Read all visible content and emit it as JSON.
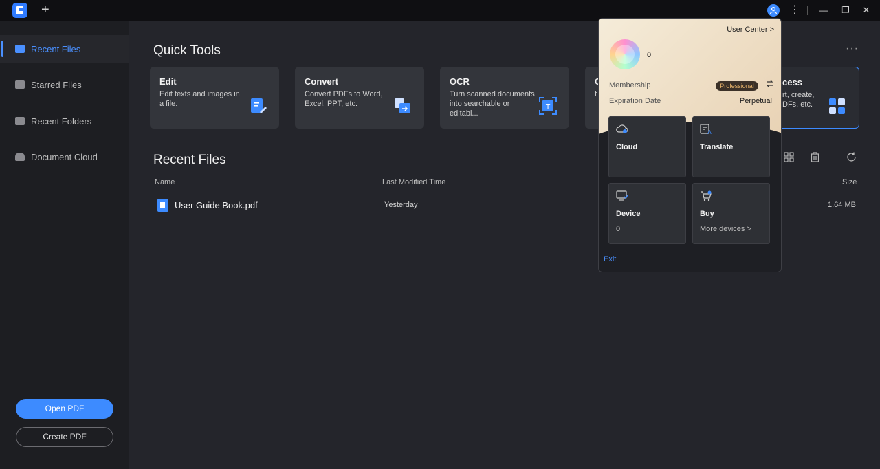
{
  "titlebar": {
    "new_tab": "+",
    "more": "⋮",
    "minimize": "—",
    "restore": "❐",
    "close": "✕"
  },
  "sidebar": {
    "items": [
      {
        "label": "Recent Files",
        "icon": "document-icon",
        "active": true
      },
      {
        "label": "Starred Files",
        "icon": "star-icon",
        "active": false
      },
      {
        "label": "Recent Folders",
        "icon": "folder-icon",
        "active": false
      },
      {
        "label": "Document Cloud",
        "icon": "cloud-icon",
        "active": false
      }
    ],
    "open_pdf": "Open PDF",
    "create_pdf": "Create PDF"
  },
  "quick_tools": {
    "title": "Quick Tools",
    "more": "···",
    "tools": [
      {
        "title": "Edit",
        "desc": "Edit texts and images in a file."
      },
      {
        "title": "Convert",
        "desc": "Convert PDFs to Word, Excel, PPT, etc."
      },
      {
        "title": "OCR",
        "desc": "Turn scanned documents into searchable or editabl..."
      },
      {
        "title": "C",
        "desc": "f"
      },
      {
        "title": "cess",
        "desc": "rt, create, DFs, etc."
      }
    ]
  },
  "recent_files": {
    "title": "Recent Files",
    "columns": {
      "name": "Name",
      "modified": "Last Modified Time",
      "size": "Size"
    },
    "rows": [
      {
        "name": "User Guide Book.pdf",
        "modified": "Yesterday",
        "size": "1.64 MB"
      }
    ]
  },
  "user_popup": {
    "user_center": "User Center >",
    "username": "0",
    "membership_label": "Membership",
    "membership_value": "Professional",
    "expiration_label": "Expiration Date",
    "expiration_value": "Perpetual",
    "tiles": [
      {
        "title": "Cloud",
        "sub": "",
        "icon": "cloud-icon"
      },
      {
        "title": "Translate",
        "sub": "",
        "icon": "translate-icon"
      },
      {
        "title": "Device",
        "sub": "0",
        "icon": "device-icon"
      },
      {
        "title": "Buy",
        "sub": "More devices >",
        "icon": "cart-icon"
      }
    ],
    "exit": "Exit"
  },
  "colors": {
    "accent": "#3d8bff",
    "background": "#24252b",
    "sidebar": "#1d1e22",
    "badge_text": "#e8b46b"
  }
}
